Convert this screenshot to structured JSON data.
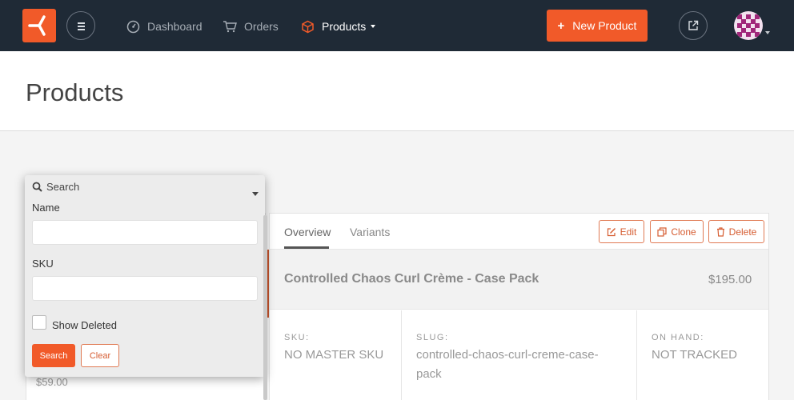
{
  "nav": {
    "items": [
      {
        "label": "Dashboard",
        "icon": "dashboard-icon"
      },
      {
        "label": "Orders",
        "icon": "cart-icon"
      },
      {
        "label": "Products",
        "icon": "cube-icon",
        "active": true
      }
    ],
    "new_button": "New Product",
    "new_button_icon": "plus-icon",
    "external_icon": "external-link-icon",
    "avatar_icon": "user-avatar-icon",
    "accent_color": "#f15a29",
    "bar_color": "#1f2a36"
  },
  "page": {
    "title": "Products"
  },
  "search_popover": {
    "title": "Search",
    "name_label": "Name",
    "name_value": "",
    "sku_label": "SKU",
    "sku_value": "",
    "show_deleted_label": "Show Deleted",
    "show_deleted_checked": false,
    "search_button": "Search",
    "clear_button": "Clear"
  },
  "product_list": {
    "visible_price": "$59.00"
  },
  "detail": {
    "tabs": [
      {
        "label": "Overview",
        "active": true
      },
      {
        "label": "Variants",
        "active": false
      }
    ],
    "actions": [
      {
        "label": "Edit",
        "icon": "edit-icon"
      },
      {
        "label": "Clone",
        "icon": "clone-icon"
      },
      {
        "label": "Delete",
        "icon": "trash-icon"
      }
    ],
    "product_name": "Controlled Chaos Curl Crème - Case Pack",
    "product_price": "$195.00",
    "sku_label": "SKU:",
    "sku_value": "NO MASTER SKU",
    "slug_label": "SLUG:",
    "slug_value_line1": "controlled-chaos-curl-creme-case-",
    "slug_value_line2": "pack",
    "on_hand_label": "ON HAND:",
    "on_hand_value": "NOT TRACKED"
  }
}
